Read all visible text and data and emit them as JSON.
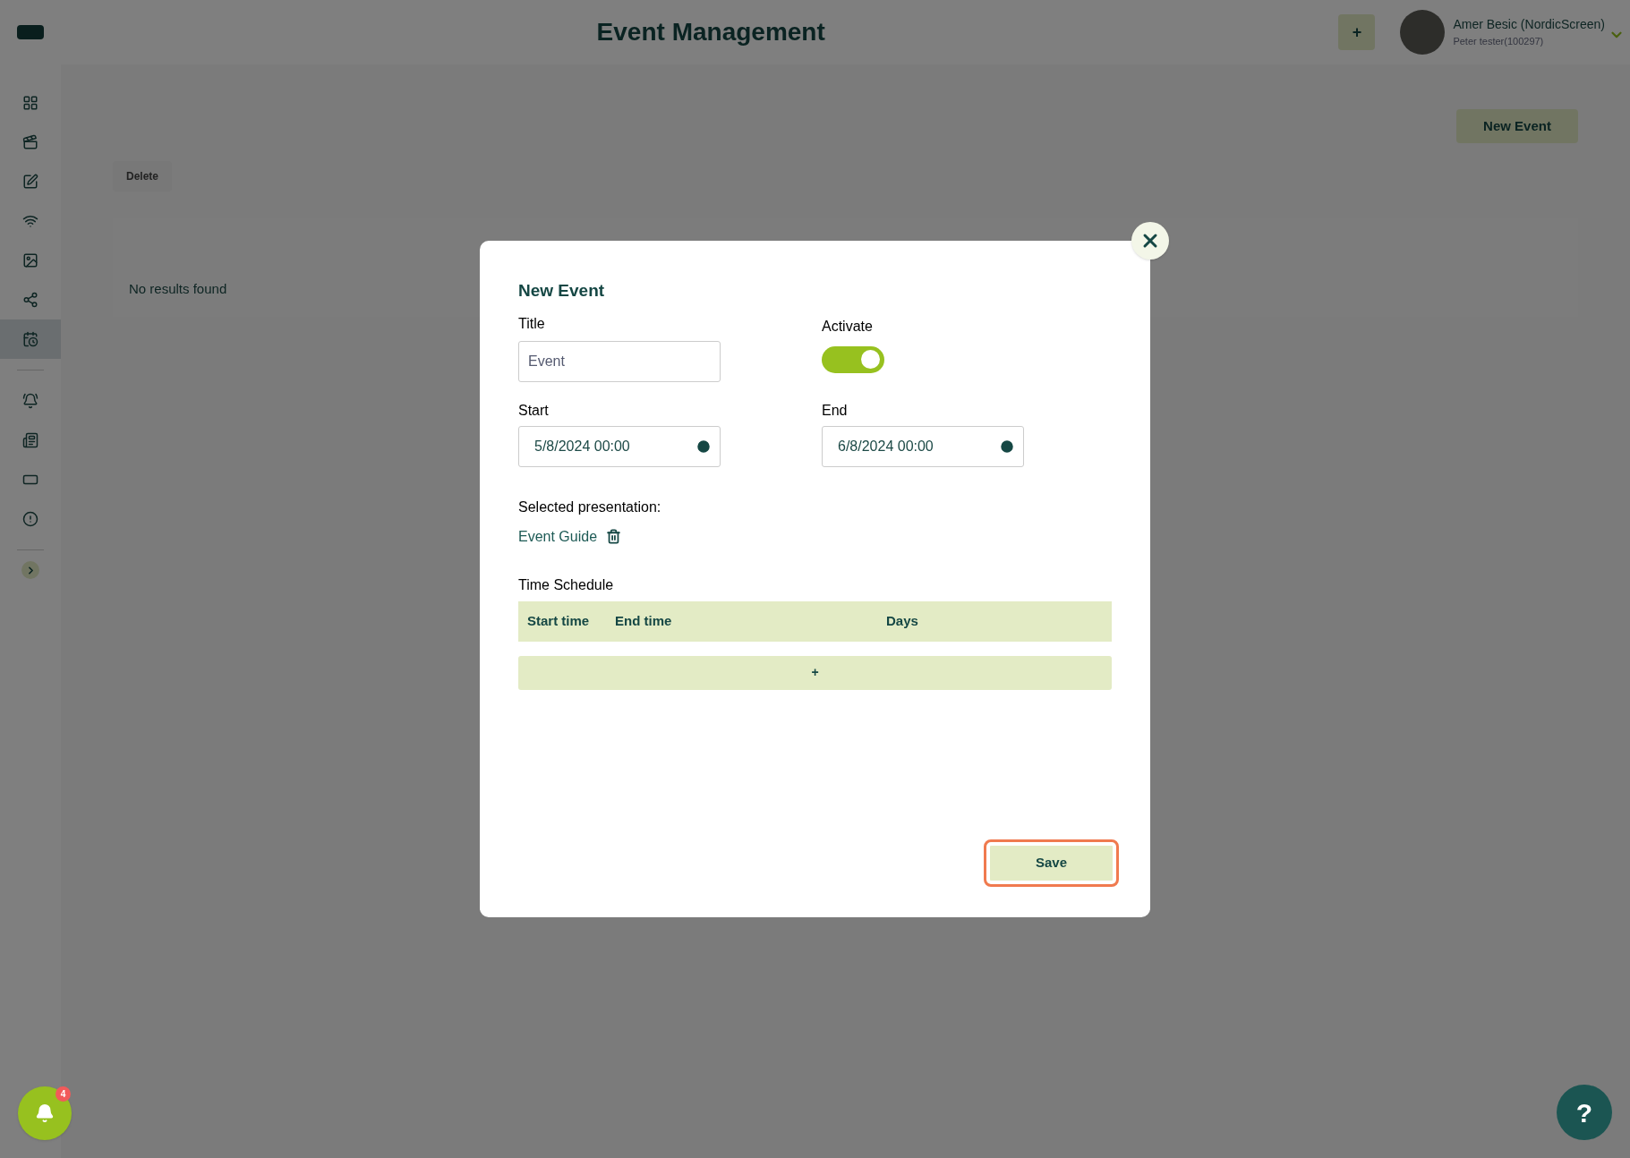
{
  "header": {
    "title": "Event Management",
    "add_button": "+",
    "user_name": "Amer Besic (NordicScreen)",
    "user_sub": "Peter tester(100297)"
  },
  "sidebar": {
    "groups": [
      [
        {
          "selected": false
        },
        {
          "selected": false
        },
        {
          "selected": false
        },
        {
          "selected": false
        },
        {
          "selected": false
        },
        {
          "selected": false
        },
        {
          "selected": true
        }
      ],
      [
        {
          "selected": false
        },
        {
          "selected": false
        },
        {
          "selected": false
        },
        {
          "selected": false
        }
      ]
    ]
  },
  "page": {
    "new_event_button": "New Event",
    "delete_button": "Delete",
    "empty_text": "No results found"
  },
  "modal": {
    "title": "New Event",
    "title_label": "Title",
    "title_placeholder": "Event",
    "activate_label": "Activate",
    "activate_on": true,
    "start_label": "Start",
    "start_value": "5/8/2024 00:00",
    "end_label": "End",
    "end_value": "6/8/2024 00:00",
    "presentation_label": "Selected presentation:",
    "presentation_name": "Event Guide",
    "schedule_label": "Time Schedule",
    "schedule_columns": [
      "Start time",
      "End time",
      "Days"
    ],
    "add_row_button": "+",
    "save_button": "Save",
    "save_focused": true
  },
  "notifications": {
    "badge": "4"
  },
  "help_button": "?"
}
